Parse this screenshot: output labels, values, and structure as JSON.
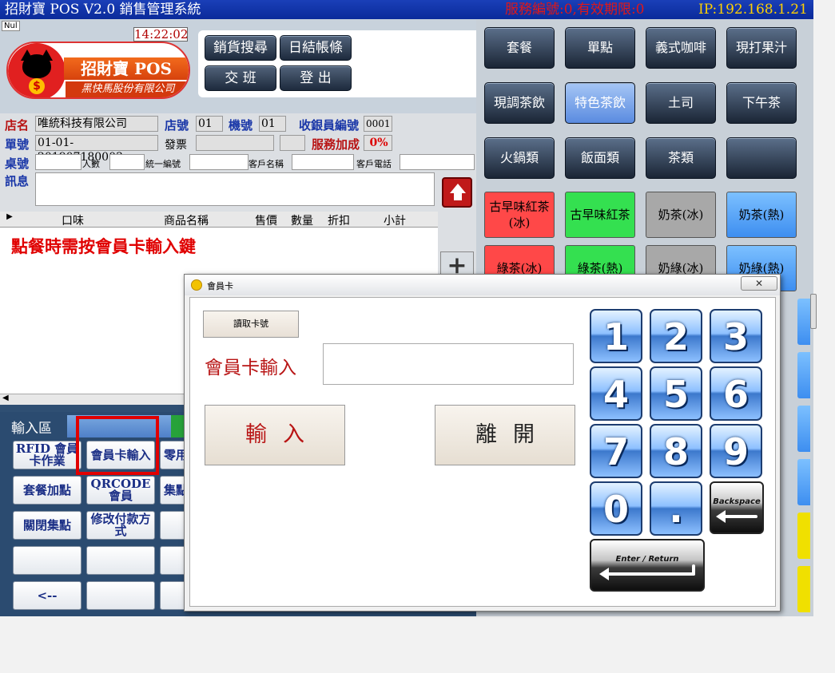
{
  "titlebar": {
    "title": "招財寶 POS V2.0 銷售管理系統",
    "service": "服務編號:0,有效期限:0",
    "ip": "IP:192.168.1.21"
  },
  "header": {
    "nul": "Nul",
    "clock": "14:22:02",
    "logo_text": "招財寶 POS",
    "logo_sub": "黑快馬股份有限公司",
    "coin": "$",
    "buttons": {
      "sales_search": "銷貨搜尋",
      "daily_report": "日結帳條",
      "shift": "交 班",
      "logout": "登 出"
    }
  },
  "store": {
    "store_name_label": "店名",
    "store_name": "唯統科技有限公司",
    "store_no_label": "店號",
    "store_no": "01",
    "machine_label": "機號",
    "machine_no": "01",
    "cashier_label": "收銀員編號",
    "cashier_no": "0001",
    "order_label": "單號",
    "order_no": "01-01-201907180003",
    "invoice_label": "發票",
    "invoice_no": "",
    "service_label": "服務加成",
    "service_rate": "0%",
    "table_label": "桌號",
    "people_label": "人數",
    "tax_id_label": "統一編號",
    "customer_name_label": "客戶名稱",
    "customer_phone_label": "客戶電話",
    "msg_label": "訊息"
  },
  "grid": {
    "columns": [
      "口味",
      "商品名稱",
      "售價",
      "數量",
      "折扣",
      "小計"
    ],
    "hint": "點餐時需按會員卡輸入鍵"
  },
  "input_area": {
    "title": "輸入區",
    "buttons": [
      "RFID 會員卡作業",
      "會員卡輸入",
      "零用",
      "套餐加點",
      "QRCODE會員",
      "集點",
      "關閉集點",
      "修改付款方式",
      "",
      "",
      "",
      "",
      "<--",
      "",
      ""
    ]
  },
  "menu": {
    "categories": [
      "套餐",
      "單點",
      "義式咖啡",
      "現打果汁",
      "現調茶飲",
      "特色茶飲",
      "土司",
      "下午茶",
      "火鍋類",
      "飯面類",
      "茶類",
      ""
    ],
    "selected": "特色茶飲",
    "products": [
      {
        "label": "古早味紅茶(冰)",
        "color": "red"
      },
      {
        "label": "古早味紅茶",
        "color": "green"
      },
      {
        "label": "奶茶(冰)",
        "color": "gray"
      },
      {
        "label": "奶茶(熱)",
        "color": "blue"
      },
      {
        "label": "綠茶(冰)",
        "color": "red"
      },
      {
        "label": "綠茶(熱)",
        "color": "green"
      },
      {
        "label": "奶綠(冰)",
        "color": "gray"
      },
      {
        "label": "奶綠(熱)",
        "color": "blue"
      }
    ]
  },
  "dialog": {
    "title": "會員卡",
    "close": "✕",
    "read_card": "讀取卡號",
    "card_label": "會員卡輸入",
    "card_value": "",
    "enter": "輸入",
    "leave": "離開",
    "keys": [
      "1",
      "2",
      "3",
      "4",
      "5",
      "6",
      "7",
      "8",
      "9",
      "0",
      "."
    ],
    "backspace": "Backspace",
    "enter_key": "Enter / Return"
  },
  "colors": {
    "accent_red": "#b81414",
    "title_blue": "#0a2a9a",
    "selected_category": "#5a8be0"
  }
}
